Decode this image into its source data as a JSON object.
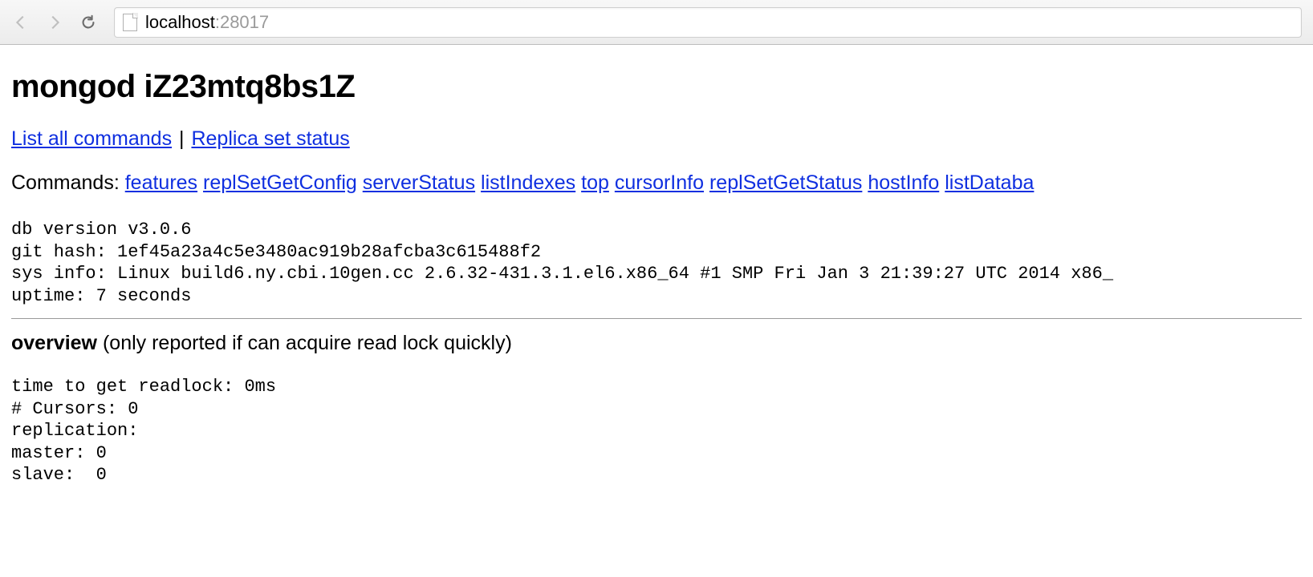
{
  "browser": {
    "url_host": "localhost",
    "url_port": ":28017"
  },
  "page": {
    "title": "mongod iZ23mtq8bs1Z",
    "links": {
      "list_all": "List all commands",
      "sep": " | ",
      "replica": "Replica set status"
    },
    "commands": {
      "prefix": "Commands: ",
      "items": [
        "features",
        "replSetGetConfig",
        "serverStatus",
        "listIndexes",
        "top",
        "cursorInfo",
        "replSetGetStatus",
        "hostInfo",
        "listDataba"
      ]
    },
    "info": {
      "db_version": "db version v3.0.6",
      "git_hash": "git hash: 1ef45a23a4c5e3480ac919b28afcba3c615488f2",
      "sys_info": "sys info: Linux build6.ny.cbi.10gen.cc 2.6.32-431.3.1.el6.x86_64 #1 SMP Fri Jan 3 21:39:27 UTC 2014 x86_",
      "uptime": "uptime: 7 seconds"
    },
    "overview": {
      "heading_bold": "overview",
      "heading_rest": " (only reported if can acquire read lock quickly)",
      "lines": {
        "readlock": "time to get readlock: 0ms",
        "cursors": "# Cursors: 0",
        "replication": "replication: ",
        "master": "master: 0",
        "slave": "slave:  0"
      }
    }
  }
}
